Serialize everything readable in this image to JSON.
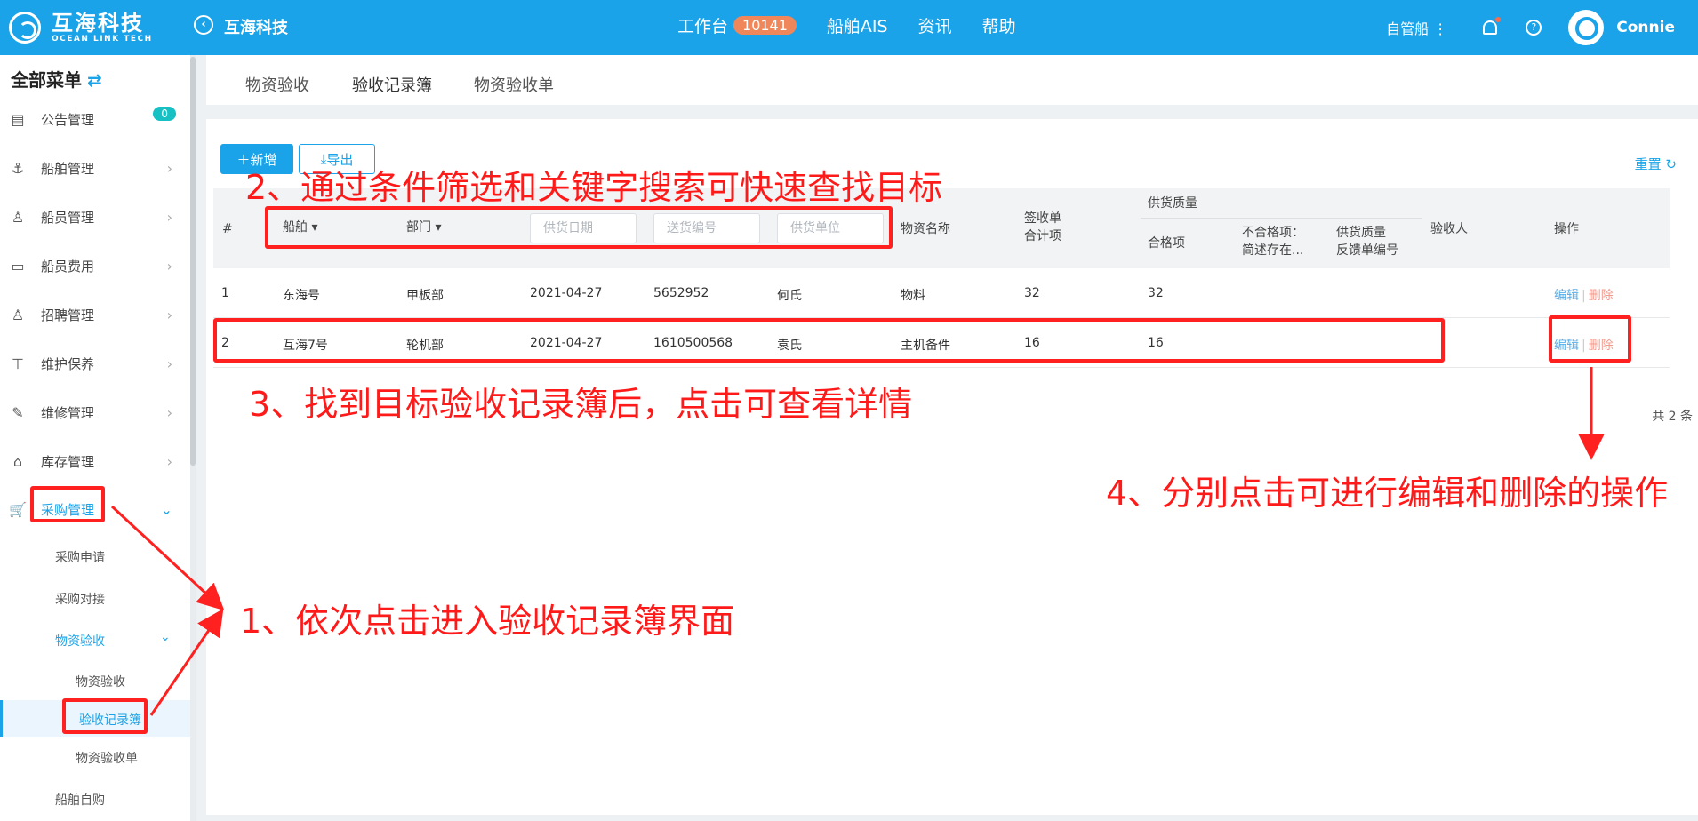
{
  "topbar": {
    "logo_cn": "互海科技",
    "logo_en": "OCEAN LINK TECH",
    "company": "互海科技",
    "nav": [
      {
        "label": "工作台",
        "badge": "10141"
      },
      {
        "label": "船舶AIS"
      },
      {
        "label": "资讯"
      },
      {
        "label": "帮助"
      }
    ],
    "manage": "自管船",
    "user": "Connie"
  },
  "sidebar": {
    "title": "全部菜单",
    "notice_count": "0",
    "items": [
      {
        "label": "公告管理",
        "icon": "book-icon"
      },
      {
        "label": "船舶管理",
        "icon": "anchor-icon"
      },
      {
        "label": "船员管理",
        "icon": "person-icon"
      },
      {
        "label": "船员费用",
        "icon": "wallet-icon"
      },
      {
        "label": "招聘管理",
        "icon": "recruit-icon"
      },
      {
        "label": "维护保养",
        "icon": "hammer-icon"
      },
      {
        "label": "维修管理",
        "icon": "wrench-icon"
      },
      {
        "label": "库存管理",
        "icon": "home-icon"
      },
      {
        "label": "采购管理",
        "icon": "cart-icon"
      }
    ],
    "sub": {
      "apply": "采购申请",
      "match": "采购对接",
      "accept": "物资验收",
      "accept_check": "物资验收",
      "accept_book": "验收记录簿",
      "accept_sheet": "物资验收单",
      "self_buy": "船舶自购"
    }
  },
  "tabs": [
    "物资验收",
    "验收记录簿",
    "物资验收单"
  ],
  "toolbar": {
    "add": "新增",
    "export": "导出",
    "reset": "重置"
  },
  "table": {
    "headers": {
      "index": "#",
      "ship": "船舶",
      "dept": "部门",
      "material": "物资名称",
      "sign_line1": "签收单",
      "sign_line2": "合计项",
      "quality": "供货质量",
      "pass": "合格项",
      "fail_line1": "不合格项：",
      "fail_line2": "简述存在...",
      "feedback_line1": "供货质量",
      "feedback_line2": "反馈单编号",
      "inspector": "验收人",
      "ops": "操作"
    },
    "filters": {
      "date": "供货日期",
      "delivery_no": "送货编号",
      "supplier": "供货单位"
    },
    "rows": [
      {
        "idx": "1",
        "ship": "东海号",
        "dept": "甲板部",
        "date": "2021-04-27",
        "no": "5652952",
        "supplier": "何氏",
        "material": "物料",
        "sign": "32",
        "pass": "32"
      },
      {
        "idx": "2",
        "ship": "互海7号",
        "dept": "轮机部",
        "date": "2021-04-27",
        "no": "1610500568",
        "supplier": "袁氏",
        "material": "主机备件",
        "sign": "16",
        "pass": "16"
      }
    ],
    "edit": "编辑",
    "delete": "删除",
    "total": "共 2 条"
  },
  "annotations": {
    "step1": "1、依次点击进入验收记录簿界面",
    "step2": "2、通过条件筛选和关键字搜索可快速查找目标",
    "step3": "3、找到目标验收记录簿后，点击可查看详情",
    "step4": "4、分别点击可进行编辑和删除的操作"
  }
}
